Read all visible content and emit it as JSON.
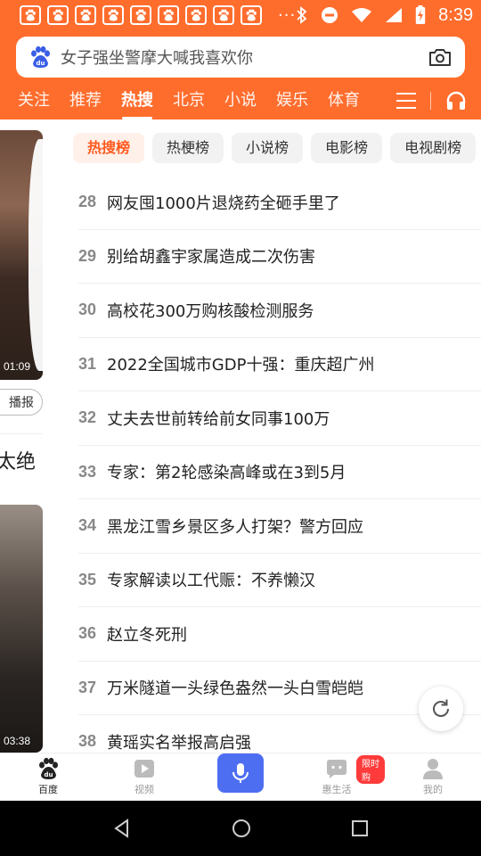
{
  "status_bar": {
    "notification_icon_count": 9,
    "notification_icon_name": "baidu-paw-icon",
    "more_dots": "···",
    "time": "8:39"
  },
  "search": {
    "placeholder": "女子强坐警摩大喊我喜欢你"
  },
  "tabs": [
    {
      "label": "关注",
      "active": false
    },
    {
      "label": "推荐",
      "active": false
    },
    {
      "label": "热搜",
      "active": true
    },
    {
      "label": "北京",
      "active": false
    },
    {
      "label": "小说",
      "active": false
    },
    {
      "label": "娱乐",
      "active": false
    },
    {
      "label": "体育",
      "active": false
    }
  ],
  "left_column": {
    "video1_duration": "01:09",
    "play_chip_label": "播报",
    "title_fragment": "太绝",
    "video2_duration": "03:38"
  },
  "chips": [
    {
      "label": "热搜榜",
      "active": true
    },
    {
      "label": "热梗榜",
      "active": false
    },
    {
      "label": "小说榜",
      "active": false
    },
    {
      "label": "电影榜",
      "active": false
    },
    {
      "label": "电视剧榜",
      "active": false
    }
  ],
  "hot_list": [
    {
      "rank": "28",
      "title": "网友囤1000片退烧药全砸手里了"
    },
    {
      "rank": "29",
      "title": "别给胡鑫宇家属造成二次伤害"
    },
    {
      "rank": "30",
      "title": "高校花300万购核酸检测服务"
    },
    {
      "rank": "31",
      "title": "2022全国城市GDP十强：重庆超广州"
    },
    {
      "rank": "32",
      "title": "丈夫去世前转给前女同事100万"
    },
    {
      "rank": "33",
      "title": "专家：第2轮感染高峰或在3到5月"
    },
    {
      "rank": "34",
      "title": "黑龙江雪乡景区多人打架？警方回应"
    },
    {
      "rank": "35",
      "title": "专家解读以工代赈：不养懒汉"
    },
    {
      "rank": "36",
      "title": "赵立冬死刑"
    },
    {
      "rank": "37",
      "title": "万米隧道一头绿色盎然一头白雪皑皑"
    },
    {
      "rank": "38",
      "title": "黄瑶实名举报高启强"
    }
  ],
  "bottom_nav": {
    "home": "百度",
    "video": "视频",
    "life": "惠生活",
    "life_badge": "限时购",
    "mine": "我的"
  },
  "colors": {
    "brand_orange": "#ff6d2d",
    "voice_blue": "#4e6ef2",
    "active_chip_text": "#ff5a1f"
  }
}
